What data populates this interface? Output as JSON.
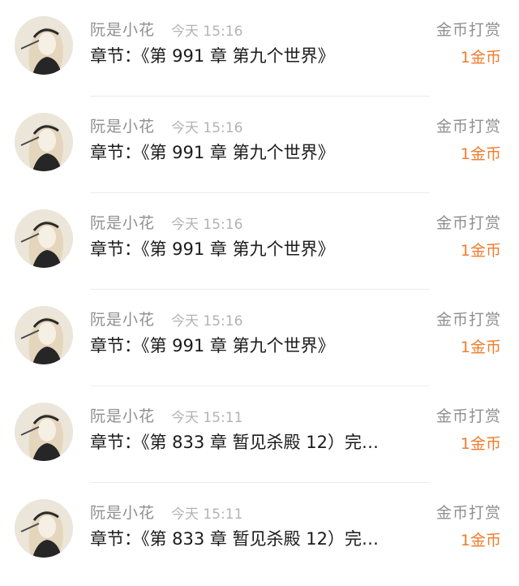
{
  "colors": {
    "accent": "#f07c2c",
    "muted": "#8f8f8f",
    "time": "#b3b3b3",
    "text": "#1b1b1b"
  },
  "avatar_icon": "user-avatar-icon",
  "records": [
    {
      "name": "阮是小花",
      "time": "今天 15:16",
      "chapter": "章节：《第 991 章 第九个世界》",
      "tip_label": "金币打赏",
      "amount": "1金币"
    },
    {
      "name": "阮是小花",
      "time": "今天 15:16",
      "chapter": "章节：《第 991 章 第九个世界》",
      "tip_label": "金币打赏",
      "amount": "1金币"
    },
    {
      "name": "阮是小花",
      "time": "今天 15:16",
      "chapter": "章节：《第 991 章 第九个世界》",
      "tip_label": "金币打赏",
      "amount": "1金币"
    },
    {
      "name": "阮是小花",
      "time": "今天 15:16",
      "chapter": "章节：《第 991 章 第九个世界》",
      "tip_label": "金币打赏",
      "amount": "1金币"
    },
    {
      "name": "阮是小花",
      "time": "今天 15:11",
      "chapter": "章节：《第 833 章 暂见杀殿 12）完…",
      "tip_label": "金币打赏",
      "amount": "1金币"
    },
    {
      "name": "阮是小花",
      "time": "今天 15:11",
      "chapter": "章节：《第 833 章 暂见杀殿 12）完…",
      "tip_label": "金币打赏",
      "amount": "1金币"
    }
  ]
}
